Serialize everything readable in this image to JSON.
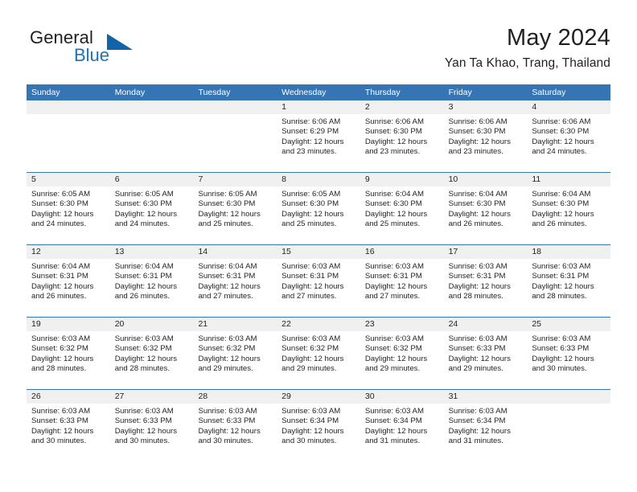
{
  "brand": {
    "name_part1": "General",
    "name_part2": "Blue",
    "accent_color": "#1363a8"
  },
  "header": {
    "title": "May 2024",
    "subtitle": "Yan Ta Khao, Trang, Thailand"
  },
  "calendar": {
    "header_bg": "#3575b4",
    "daynum_bg": "#f0f0f0",
    "weekday_names": [
      "Sunday",
      "Monday",
      "Tuesday",
      "Wednesday",
      "Thursday",
      "Friday",
      "Saturday"
    ],
    "weeks": [
      [
        {
          "day": "",
          "lines": []
        },
        {
          "day": "",
          "lines": []
        },
        {
          "day": "",
          "lines": []
        },
        {
          "day": "1",
          "lines": [
            "Sunrise: 6:06 AM",
            "Sunset: 6:29 PM",
            "Daylight: 12 hours",
            "and 23 minutes."
          ]
        },
        {
          "day": "2",
          "lines": [
            "Sunrise: 6:06 AM",
            "Sunset: 6:30 PM",
            "Daylight: 12 hours",
            "and 23 minutes."
          ]
        },
        {
          "day": "3",
          "lines": [
            "Sunrise: 6:06 AM",
            "Sunset: 6:30 PM",
            "Daylight: 12 hours",
            "and 23 minutes."
          ]
        },
        {
          "day": "4",
          "lines": [
            "Sunrise: 6:06 AM",
            "Sunset: 6:30 PM",
            "Daylight: 12 hours",
            "and 24 minutes."
          ]
        }
      ],
      [
        {
          "day": "5",
          "lines": [
            "Sunrise: 6:05 AM",
            "Sunset: 6:30 PM",
            "Daylight: 12 hours",
            "and 24 minutes."
          ]
        },
        {
          "day": "6",
          "lines": [
            "Sunrise: 6:05 AM",
            "Sunset: 6:30 PM",
            "Daylight: 12 hours",
            "and 24 minutes."
          ]
        },
        {
          "day": "7",
          "lines": [
            "Sunrise: 6:05 AM",
            "Sunset: 6:30 PM",
            "Daylight: 12 hours",
            "and 25 minutes."
          ]
        },
        {
          "day": "8",
          "lines": [
            "Sunrise: 6:05 AM",
            "Sunset: 6:30 PM",
            "Daylight: 12 hours",
            "and 25 minutes."
          ]
        },
        {
          "day": "9",
          "lines": [
            "Sunrise: 6:04 AM",
            "Sunset: 6:30 PM",
            "Daylight: 12 hours",
            "and 25 minutes."
          ]
        },
        {
          "day": "10",
          "lines": [
            "Sunrise: 6:04 AM",
            "Sunset: 6:30 PM",
            "Daylight: 12 hours",
            "and 26 minutes."
          ]
        },
        {
          "day": "11",
          "lines": [
            "Sunrise: 6:04 AM",
            "Sunset: 6:30 PM",
            "Daylight: 12 hours",
            "and 26 minutes."
          ]
        }
      ],
      [
        {
          "day": "12",
          "lines": [
            "Sunrise: 6:04 AM",
            "Sunset: 6:31 PM",
            "Daylight: 12 hours",
            "and 26 minutes."
          ]
        },
        {
          "day": "13",
          "lines": [
            "Sunrise: 6:04 AM",
            "Sunset: 6:31 PM",
            "Daylight: 12 hours",
            "and 26 minutes."
          ]
        },
        {
          "day": "14",
          "lines": [
            "Sunrise: 6:04 AM",
            "Sunset: 6:31 PM",
            "Daylight: 12 hours",
            "and 27 minutes."
          ]
        },
        {
          "day": "15",
          "lines": [
            "Sunrise: 6:03 AM",
            "Sunset: 6:31 PM",
            "Daylight: 12 hours",
            "and 27 minutes."
          ]
        },
        {
          "day": "16",
          "lines": [
            "Sunrise: 6:03 AM",
            "Sunset: 6:31 PM",
            "Daylight: 12 hours",
            "and 27 minutes."
          ]
        },
        {
          "day": "17",
          "lines": [
            "Sunrise: 6:03 AM",
            "Sunset: 6:31 PM",
            "Daylight: 12 hours",
            "and 28 minutes."
          ]
        },
        {
          "day": "18",
          "lines": [
            "Sunrise: 6:03 AM",
            "Sunset: 6:31 PM",
            "Daylight: 12 hours",
            "and 28 minutes."
          ]
        }
      ],
      [
        {
          "day": "19",
          "lines": [
            "Sunrise: 6:03 AM",
            "Sunset: 6:32 PM",
            "Daylight: 12 hours",
            "and 28 minutes."
          ]
        },
        {
          "day": "20",
          "lines": [
            "Sunrise: 6:03 AM",
            "Sunset: 6:32 PM",
            "Daylight: 12 hours",
            "and 28 minutes."
          ]
        },
        {
          "day": "21",
          "lines": [
            "Sunrise: 6:03 AM",
            "Sunset: 6:32 PM",
            "Daylight: 12 hours",
            "and 29 minutes."
          ]
        },
        {
          "day": "22",
          "lines": [
            "Sunrise: 6:03 AM",
            "Sunset: 6:32 PM",
            "Daylight: 12 hours",
            "and 29 minutes."
          ]
        },
        {
          "day": "23",
          "lines": [
            "Sunrise: 6:03 AM",
            "Sunset: 6:32 PM",
            "Daylight: 12 hours",
            "and 29 minutes."
          ]
        },
        {
          "day": "24",
          "lines": [
            "Sunrise: 6:03 AM",
            "Sunset: 6:33 PM",
            "Daylight: 12 hours",
            "and 29 minutes."
          ]
        },
        {
          "day": "25",
          "lines": [
            "Sunrise: 6:03 AM",
            "Sunset: 6:33 PM",
            "Daylight: 12 hours",
            "and 30 minutes."
          ]
        }
      ],
      [
        {
          "day": "26",
          "lines": [
            "Sunrise: 6:03 AM",
            "Sunset: 6:33 PM",
            "Daylight: 12 hours",
            "and 30 minutes."
          ]
        },
        {
          "day": "27",
          "lines": [
            "Sunrise: 6:03 AM",
            "Sunset: 6:33 PM",
            "Daylight: 12 hours",
            "and 30 minutes."
          ]
        },
        {
          "day": "28",
          "lines": [
            "Sunrise: 6:03 AM",
            "Sunset: 6:33 PM",
            "Daylight: 12 hours",
            "and 30 minutes."
          ]
        },
        {
          "day": "29",
          "lines": [
            "Sunrise: 6:03 AM",
            "Sunset: 6:34 PM",
            "Daylight: 12 hours",
            "and 30 minutes."
          ]
        },
        {
          "day": "30",
          "lines": [
            "Sunrise: 6:03 AM",
            "Sunset: 6:34 PM",
            "Daylight: 12 hours",
            "and 31 minutes."
          ]
        },
        {
          "day": "31",
          "lines": [
            "Sunrise: 6:03 AM",
            "Sunset: 6:34 PM",
            "Daylight: 12 hours",
            "and 31 minutes."
          ]
        },
        {
          "day": "",
          "lines": []
        }
      ]
    ]
  }
}
